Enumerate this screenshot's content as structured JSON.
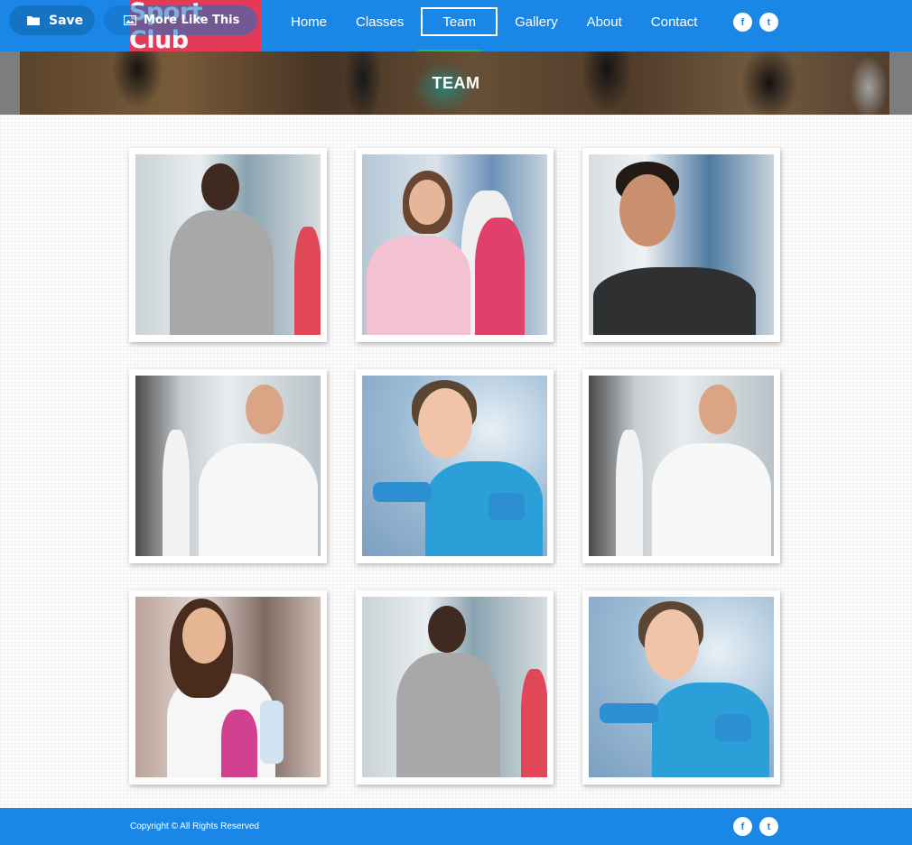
{
  "toolbar": {
    "save_label": "Save",
    "more_label": "More Like This"
  },
  "brand": {
    "logo_text": "Sport Club",
    "logo_color": "#f0364f",
    "primary_color": "#1a86e5"
  },
  "nav": {
    "items": [
      {
        "label": "Home"
      },
      {
        "label": "Classes"
      },
      {
        "label": "Team",
        "active": true
      },
      {
        "label": "Gallery"
      },
      {
        "label": "About"
      },
      {
        "label": "Contact"
      }
    ]
  },
  "social": {
    "facebook_glyph": "f",
    "twitter_glyph": "t",
    "icons": [
      "facebook-icon",
      "twitter-icon"
    ]
  },
  "banner": {
    "title": "TEAM"
  },
  "team": {
    "photos": [
      {
        "subject": "trainer-man-clipboard"
      },
      {
        "subject": "woman-pink-jacket"
      },
      {
        "subject": "man-smiling-black-shirt"
      },
      {
        "subject": "man-white-shirt-arms-crossed"
      },
      {
        "subject": "woman-dumbbells"
      },
      {
        "subject": "man-white-shirt-arms-crossed"
      },
      {
        "subject": "woman-towel-water"
      },
      {
        "subject": "trainer-man-clipboard"
      },
      {
        "subject": "woman-dumbbells"
      }
    ]
  },
  "footer": {
    "copyright": "Copyright © All Rights Reserved"
  }
}
